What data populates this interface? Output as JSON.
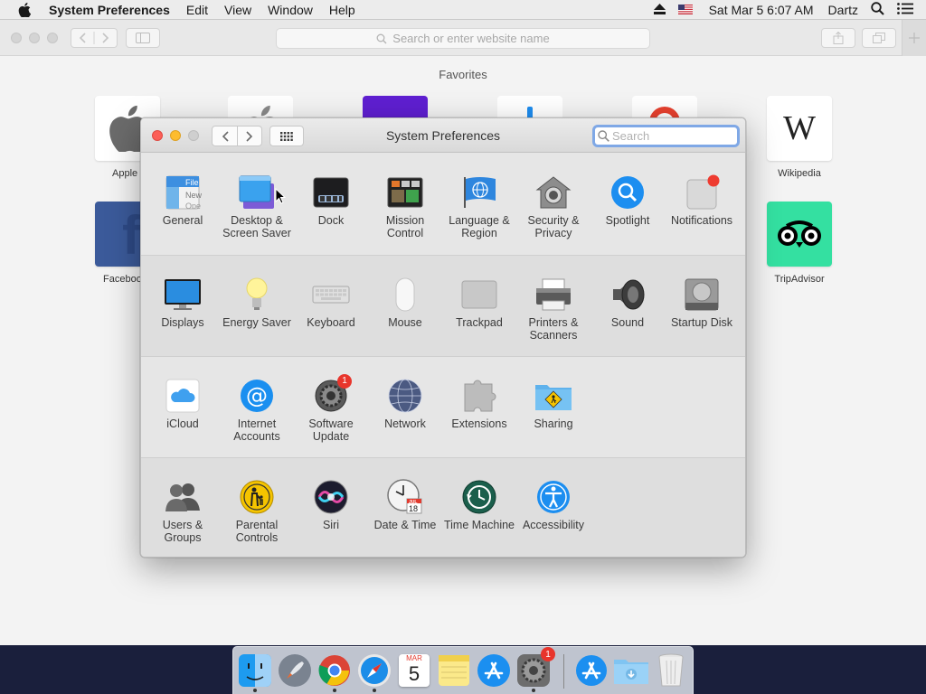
{
  "menubar": {
    "app_name": "System Preferences",
    "menus": [
      "Edit",
      "View",
      "Window",
      "Help"
    ],
    "datetime": "Sat Mar 5  6:07 AM",
    "user": "Dartz"
  },
  "safari": {
    "url_placeholder": "Search or enter website name",
    "favorites_title": "Favorites",
    "favorites": [
      {
        "label": "Apple",
        "icon": "apple-logo-icon"
      },
      {
        "label": "Facebook",
        "icon": "facebook-logo-icon"
      },
      {
        "label": "Wikipedia",
        "icon": "wikipedia-logo-icon"
      },
      {
        "label": "TripAdvisor",
        "icon": "tripadvisor-logo-icon"
      }
    ]
  },
  "syspref": {
    "title": "System Preferences",
    "search_placeholder": "Search",
    "row1": [
      {
        "label": "General"
      },
      {
        "label": "Desktop & Screen Saver"
      },
      {
        "label": "Dock"
      },
      {
        "label": "Mission Control"
      },
      {
        "label": "Language & Region"
      },
      {
        "label": "Security & Privacy"
      },
      {
        "label": "Spotlight"
      },
      {
        "label": "Notifications"
      }
    ],
    "row2": [
      {
        "label": "Displays"
      },
      {
        "label": "Energy Saver"
      },
      {
        "label": "Keyboard"
      },
      {
        "label": "Mouse"
      },
      {
        "label": "Trackpad"
      },
      {
        "label": "Printers & Scanners"
      },
      {
        "label": "Sound"
      },
      {
        "label": "Startup Disk"
      }
    ],
    "row3": [
      {
        "label": "iCloud"
      },
      {
        "label": "Internet Accounts"
      },
      {
        "label": "Software Update",
        "badge": "1"
      },
      {
        "label": "Network"
      },
      {
        "label": "Extensions"
      },
      {
        "label": "Sharing"
      }
    ],
    "row4": [
      {
        "label": "Users & Groups"
      },
      {
        "label": "Parental Controls"
      },
      {
        "label": "Siri"
      },
      {
        "label": "Date & Time"
      },
      {
        "label": "Time Machine"
      },
      {
        "label": "Accessibility"
      }
    ],
    "general_icon_text": [
      "File",
      "New",
      "Ope"
    ],
    "calendar_icon": {
      "month": "JUL",
      "day": "18"
    }
  },
  "dock": {
    "items": [
      "Finder",
      "Launchpad",
      "Google Chrome",
      "Safari",
      "Calendar",
      "Notes",
      "App Store",
      "System Preferences",
      "Downloads",
      "Applications",
      "Trash"
    ],
    "calendar_month": "MAR",
    "calendar_day": "5",
    "syspref_badge": "1"
  },
  "colors": {
    "close": "#fc5f57",
    "minimize": "#fdbc2e",
    "zoom_disabled": "#cfcfcf",
    "accent_blue": "#1c8ef0",
    "badge_red": "#e8352c"
  }
}
